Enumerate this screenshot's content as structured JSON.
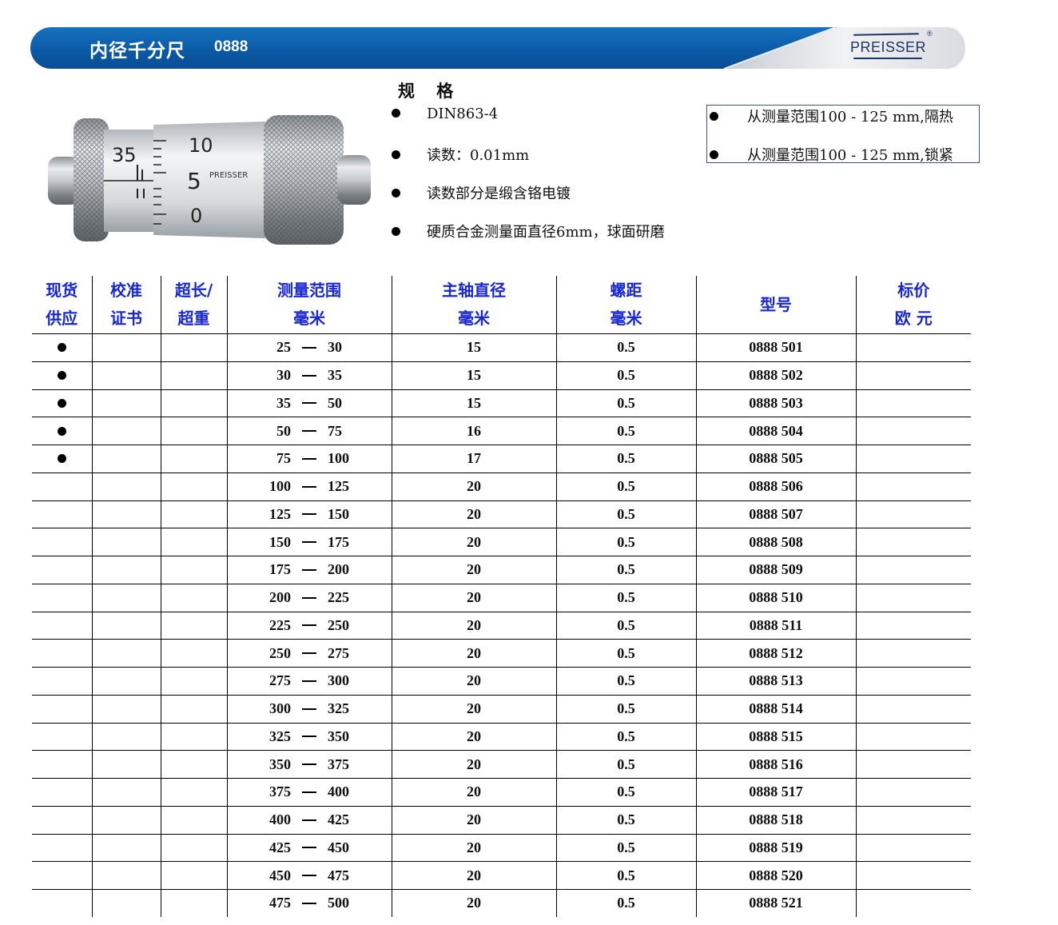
{
  "banner": {
    "title": "内径千分尺",
    "code": "0888",
    "brand": "PREISSER",
    "reg_mark": "®",
    "colors": {
      "primary": "#0b5aa6",
      "dark": "#0a3f7c",
      "brand_text": "#1c3566"
    }
  },
  "product_image": {
    "description_icon": "inside-micrometer-photo",
    "scale": {
      "sleeve_number": "35",
      "thimble_numbers": [
        "10",
        "5",
        "0"
      ],
      "engraving": "PREISSER"
    }
  },
  "specs": {
    "title": "规 格",
    "items": [
      "DIN863-4",
      "读数：0.01mm",
      "读数部分是缎含铬电镀",
      "硬质合金测量面直径6mm，球面研磨"
    ],
    "options": [
      "从测量范围100 - 125 mm,隔热",
      "从测量范围100  -  125 mm,锁紧"
    ]
  },
  "table": {
    "headers": [
      [
        "现货",
        "供应"
      ],
      [
        "校准",
        "证书"
      ],
      [
        "超长/",
        "超重"
      ],
      [
        "测量范围",
        "毫米"
      ],
      [
        "主轴直径",
        "毫米"
      ],
      [
        "螺距",
        "毫米"
      ],
      [
        "型号"
      ],
      [
        "标价",
        "欧 元"
      ]
    ],
    "header_color": "#1726d6",
    "rows": [
      {
        "stock": true,
        "range_lo": "25",
        "range_hi": "30",
        "spindle": "15",
        "pitch": "0.5",
        "model": "0888 501"
      },
      {
        "stock": true,
        "range_lo": "30",
        "range_hi": "35",
        "spindle": "15",
        "pitch": "0.5",
        "model": "0888 502"
      },
      {
        "stock": true,
        "range_lo": "35",
        "range_hi": "50",
        "spindle": "15",
        "pitch": "0.5",
        "model": "0888 503"
      },
      {
        "stock": true,
        "range_lo": "50",
        "range_hi": "75",
        "spindle": "16",
        "pitch": "0.5",
        "model": "0888 504"
      },
      {
        "stock": true,
        "range_lo": "75",
        "range_hi": "100",
        "spindle": "17",
        "pitch": "0.5",
        "model": "0888 505"
      },
      {
        "stock": false,
        "range_lo": "100",
        "range_hi": "125",
        "spindle": "20",
        "pitch": "0.5",
        "model": "0888 506"
      },
      {
        "stock": false,
        "range_lo": "125",
        "range_hi": "150",
        "spindle": "20",
        "pitch": "0.5",
        "model": "0888 507"
      },
      {
        "stock": false,
        "range_lo": "150",
        "range_hi": "175",
        "spindle": "20",
        "pitch": "0.5",
        "model": "0888 508"
      },
      {
        "stock": false,
        "range_lo": "175",
        "range_hi": "200",
        "spindle": "20",
        "pitch": "0.5",
        "model": "0888 509"
      },
      {
        "stock": false,
        "range_lo": "200",
        "range_hi": "225",
        "spindle": "20",
        "pitch": "0.5",
        "model": "0888 510"
      },
      {
        "stock": false,
        "range_lo": "225",
        "range_hi": "250",
        "spindle": "20",
        "pitch": "0.5",
        "model": "0888 511"
      },
      {
        "stock": false,
        "range_lo": "250",
        "range_hi": "275",
        "spindle": "20",
        "pitch": "0.5",
        "model": "0888 512"
      },
      {
        "stock": false,
        "range_lo": "275",
        "range_hi": "300",
        "spindle": "20",
        "pitch": "0.5",
        "model": "0888 513"
      },
      {
        "stock": false,
        "range_lo": "300",
        "range_hi": "325",
        "spindle": "20",
        "pitch": "0.5",
        "model": "0888 514"
      },
      {
        "stock": false,
        "range_lo": "325",
        "range_hi": "350",
        "spindle": "20",
        "pitch": "0.5",
        "model": "0888 515"
      },
      {
        "stock": false,
        "range_lo": "350",
        "range_hi": "375",
        "spindle": "20",
        "pitch": "0.5",
        "model": "0888 516"
      },
      {
        "stock": false,
        "range_lo": "375",
        "range_hi": "400",
        "spindle": "20",
        "pitch": "0.5",
        "model": "0888 517"
      },
      {
        "stock": false,
        "range_lo": "400",
        "range_hi": "425",
        "spindle": "20",
        "pitch": "0.5",
        "model": "0888 518"
      },
      {
        "stock": false,
        "range_lo": "425",
        "range_hi": "450",
        "spindle": "20",
        "pitch": "0.5",
        "model": "0888 519"
      },
      {
        "stock": false,
        "range_lo": "450",
        "range_hi": "475",
        "spindle": "20",
        "pitch": "0.5",
        "model": "0888 520"
      },
      {
        "stock": false,
        "range_lo": "475",
        "range_hi": "500",
        "spindle": "20",
        "pitch": "0.5",
        "model": "0888 521"
      }
    ]
  }
}
